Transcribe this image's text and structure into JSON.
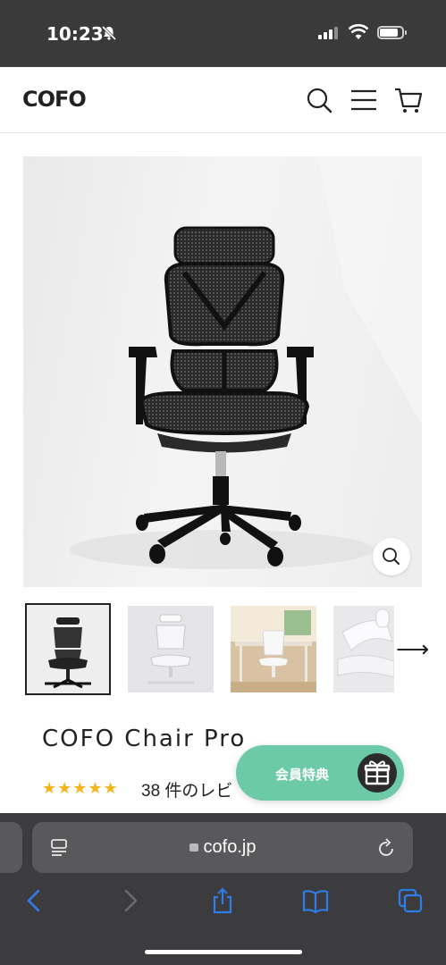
{
  "status": {
    "time": "10:23"
  },
  "header": {
    "logo": "COFO"
  },
  "product": {
    "title": "COFO Chair Pro",
    "rating_stars": "★★★★★",
    "rating_value": 5,
    "reviews_text": "38 件のレビ"
  },
  "promo": {
    "label": "会員特典"
  },
  "browser": {
    "url": "cofo.jp"
  },
  "gallery": {
    "next_arrow": "⟶"
  },
  "icons": {
    "menu": "hamburger-icon",
    "search": "search-icon",
    "cart": "cart-icon",
    "zoom": "zoom-icon",
    "gift": "gift-icon"
  },
  "colors": {
    "promo": "#6ccaa8",
    "stars": "#f2b61c",
    "browser_link": "#2f7de8"
  }
}
